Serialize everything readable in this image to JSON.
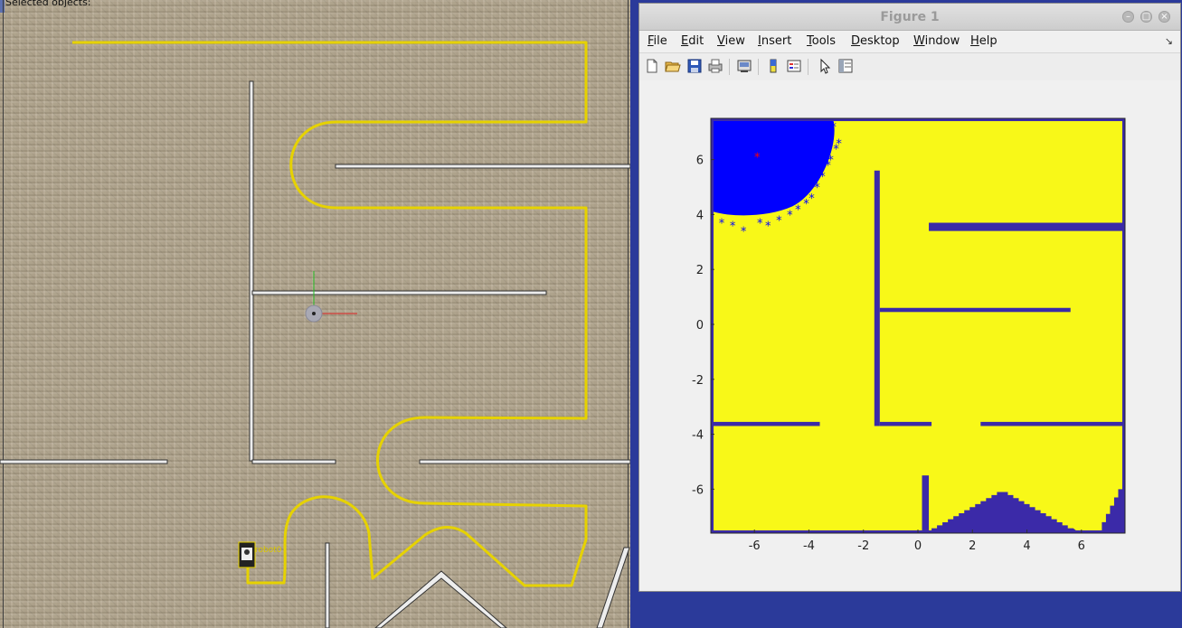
{
  "sim": {
    "status_text": "Selected objects:",
    "robot_label": "robot0"
  },
  "figure": {
    "title": "Figure 1",
    "menu": [
      {
        "pre": "",
        "key": "F",
        "post": "ile"
      },
      {
        "pre": "",
        "key": "E",
        "post": "dit"
      },
      {
        "pre": "",
        "key": "V",
        "post": "iew"
      },
      {
        "pre": "",
        "key": "I",
        "post": "nsert"
      },
      {
        "pre": "",
        "key": "T",
        "post": "ools"
      },
      {
        "pre": "",
        "key": "D",
        "post": "esktop"
      },
      {
        "pre": "",
        "key": "W",
        "post": "indow"
      },
      {
        "pre": "",
        "key": "H",
        "post": "elp"
      }
    ],
    "menu_dock_glyph": "↘",
    "toolbar_icons": [
      "new-figure-icon",
      "open-file-icon",
      "save-icon",
      "print-icon",
      "link-plot-icon",
      "insert-colorbar-icon",
      "insert-legend-icon",
      "edit-plot-arrow-icon",
      "property-inspector-icon"
    ]
  },
  "chart_data": {
    "type": "occupancy-map-with-particles",
    "xlim": [
      -7.6,
      7.6
    ],
    "ylim": [
      -7.6,
      7.5
    ],
    "xticks": [
      "-6",
      "-4",
      "-2",
      "0",
      "2",
      "4",
      "6"
    ],
    "yticks": [
      "6",
      "4",
      "2",
      "0",
      "-2",
      "-4",
      "-6"
    ],
    "free_color": "#f8f818",
    "occupied_color": "#3b2aa8",
    "particle_color": "#0000ff",
    "estimate_color": "#ff0000",
    "obstacles": [
      {
        "x0": -1.6,
        "x1": -1.4,
        "y0": -3.7,
        "y1": 5.6
      },
      {
        "x0": 0.4,
        "x1": 7.5,
        "y0": 3.4,
        "y1": 3.7
      },
      {
        "x0": -1.4,
        "x1": 5.6,
        "y0": 0.45,
        "y1": 0.6
      },
      {
        "x0": -7.5,
        "x1": -3.6,
        "y0": -3.7,
        "y1": -3.55
      },
      {
        "x0": -1.4,
        "x1": 0.5,
        "y0": -3.7,
        "y1": -3.55
      },
      {
        "x0": 2.3,
        "x1": 7.5,
        "y0": -3.7,
        "y1": -3.55
      },
      {
        "x0": 0.15,
        "x1": 0.4,
        "y0": -7.5,
        "y1": -5.5
      }
    ],
    "estimate": {
      "x": -5.9,
      "y": 6.1
    },
    "particle_cloud": {
      "center_x": -6.0,
      "center_y": 5.8,
      "extent_x": 2.8,
      "extent_y": 2.3
    }
  }
}
